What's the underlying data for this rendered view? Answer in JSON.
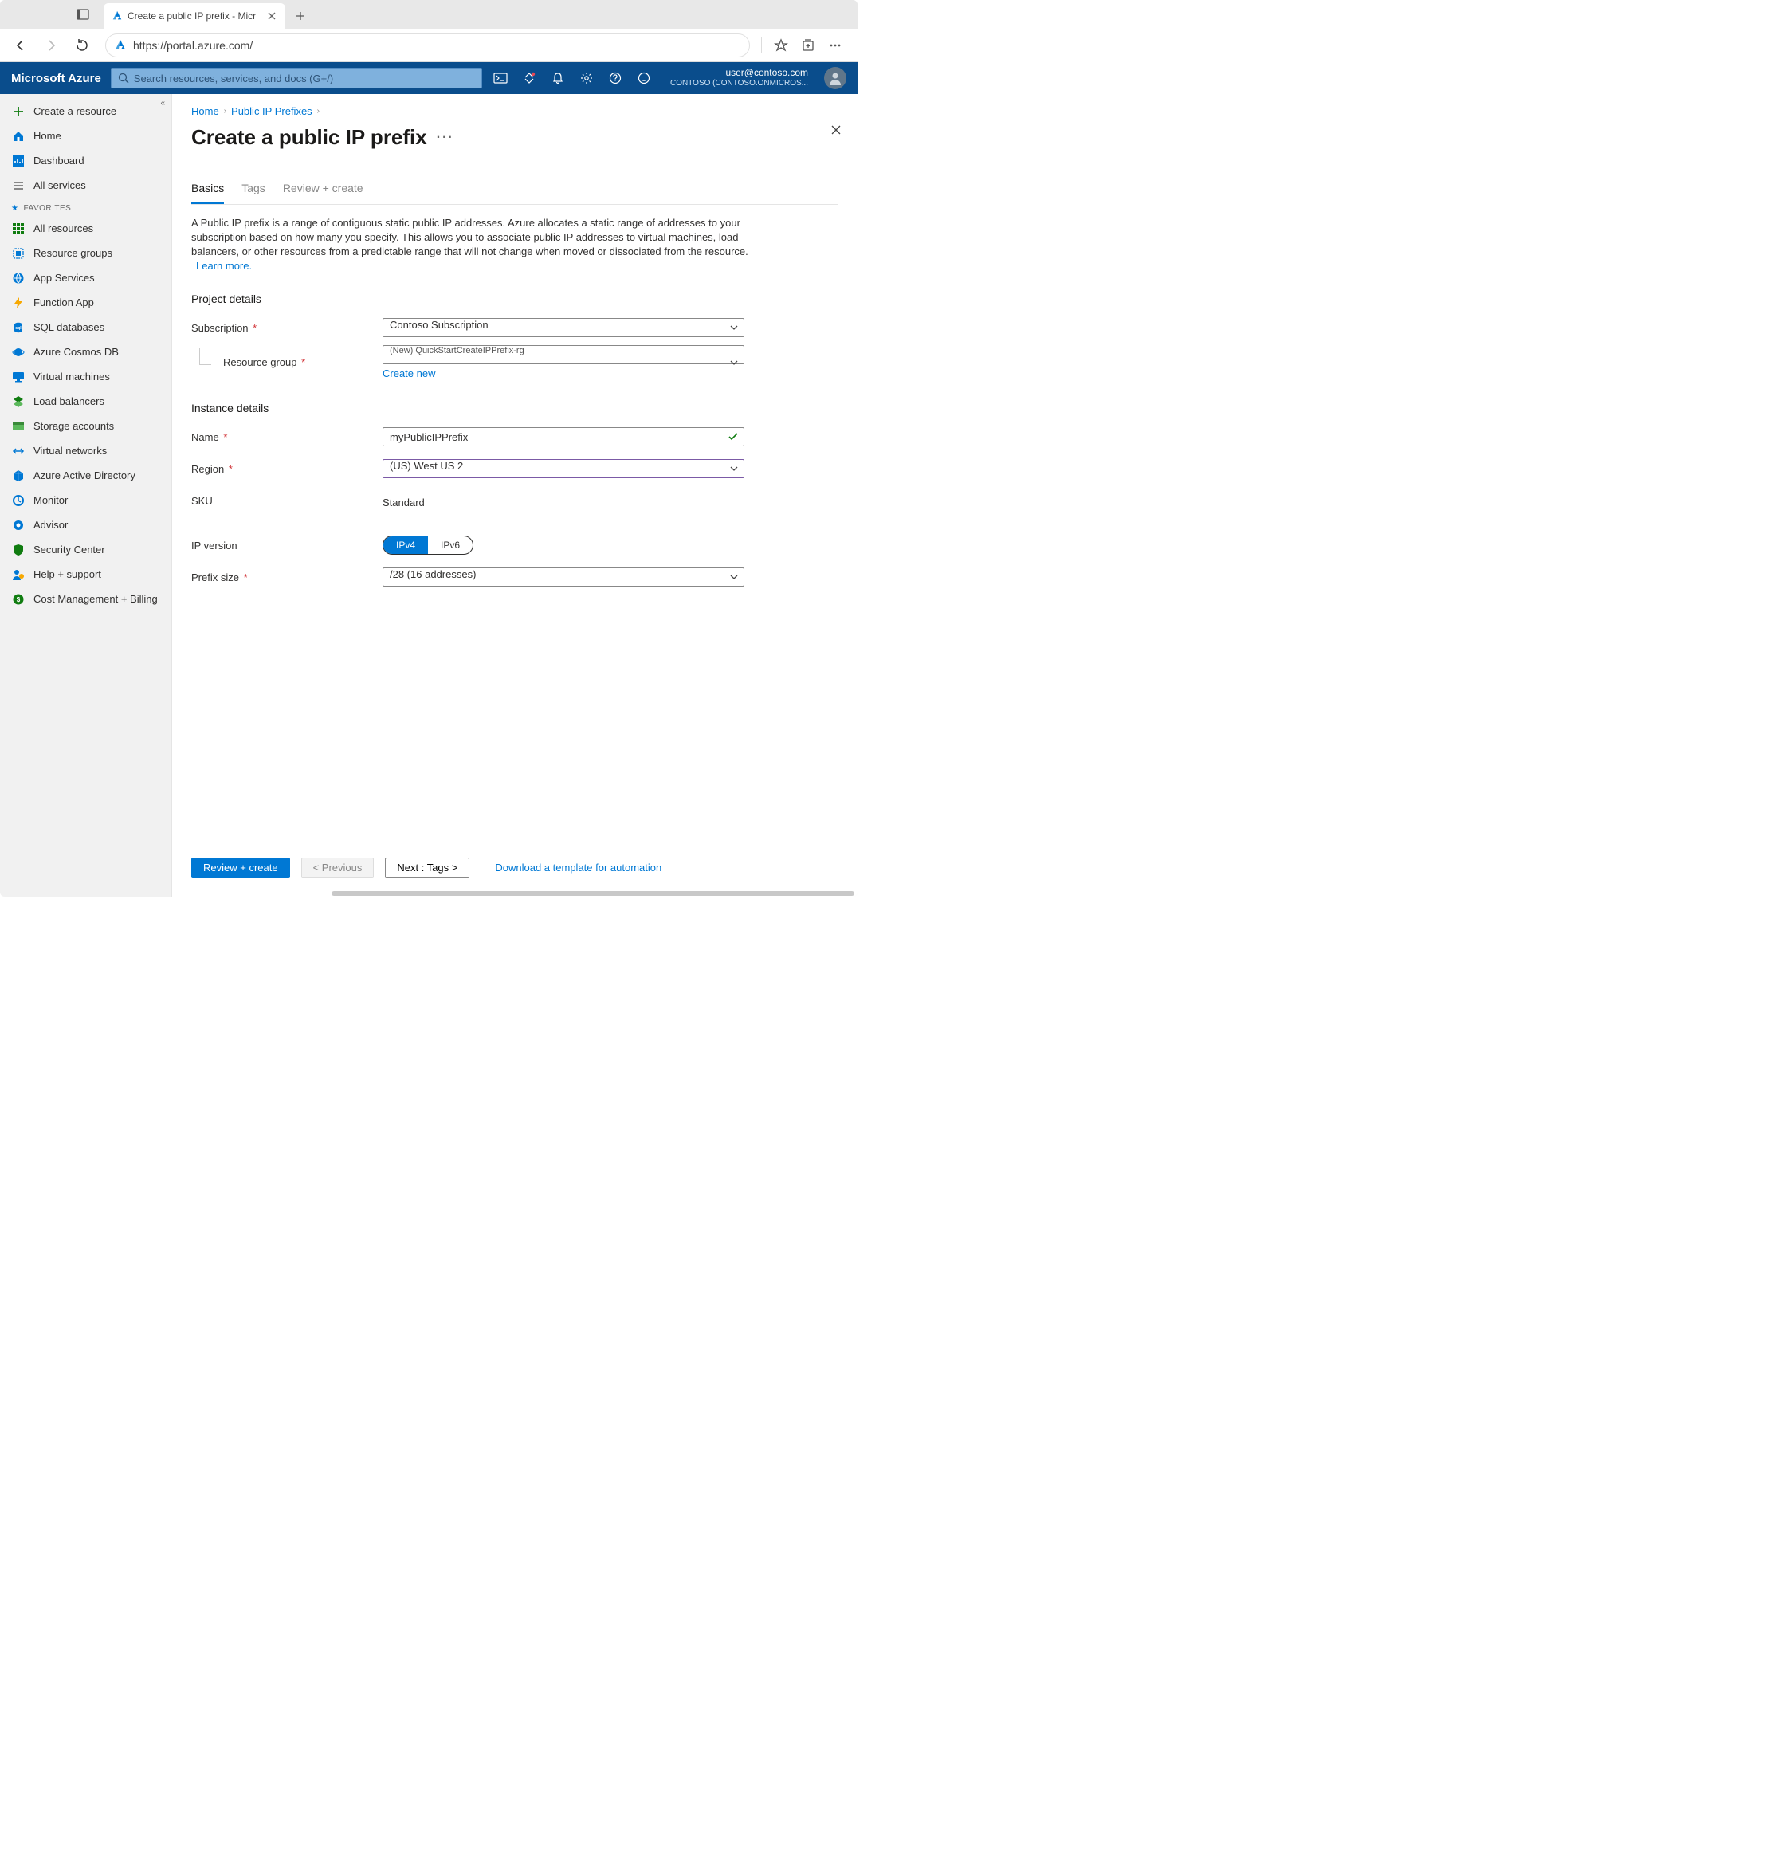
{
  "browser": {
    "tab_title": "Create a public IP prefix - Micr",
    "url": "https://portal.azure.com/"
  },
  "azure": {
    "brand": "Microsoft Azure",
    "search_placeholder": "Search resources, services, and docs (G+/)",
    "user_email": "user@contoso.com",
    "tenant": "CONTOSO (CONTOSO.ONMICROS..."
  },
  "sidebar": {
    "create": "Create a resource",
    "home": "Home",
    "dashboard": "Dashboard",
    "all_services": "All services",
    "fav_header": "FAVORITES",
    "items": [
      "All resources",
      "Resource groups",
      "App Services",
      "Function App",
      "SQL databases",
      "Azure Cosmos DB",
      "Virtual machines",
      "Load balancers",
      "Storage accounts",
      "Virtual networks",
      "Azure Active Directory",
      "Monitor",
      "Advisor",
      "Security Center",
      "Help + support",
      "Cost Management + Billing"
    ]
  },
  "breadcrumb": {
    "home": "Home",
    "prefixes": "Public IP Prefixes"
  },
  "page_title": "Create a public IP prefix",
  "tabs": {
    "basics": "Basics",
    "tags": "Tags",
    "review": "Review + create"
  },
  "description": "A Public IP prefix is a range of contiguous static public IP addresses. Azure allocates a static range of addresses to your subscription based on how many you specify. This allows you to associate public IP addresses to virtual machines, load balancers, or other resources from a predictable range that will not change when moved or dissociated from the resource.",
  "learn_more": "Learn more.",
  "sections": {
    "project": "Project details",
    "instance": "Instance details"
  },
  "labels": {
    "subscription": "Subscription",
    "resource_group": "Resource group",
    "create_new": "Create new",
    "name": "Name",
    "region": "Region",
    "sku": "SKU",
    "ip_version": "IP version",
    "prefix_size": "Prefix size"
  },
  "values": {
    "subscription": "Contoso Subscription",
    "resource_group": "(New) QuickStartCreateIPPrefix-rg",
    "name": "myPublicIPPrefix",
    "region": "(US) West US 2",
    "sku": "Standard",
    "ipv4": "IPv4",
    "ipv6": "IPv6",
    "prefix_size": "/28 (16 addresses)"
  },
  "footer": {
    "review": "Review + create",
    "previous": "< Previous",
    "next": "Next : Tags >",
    "download": "Download a template for automation"
  }
}
